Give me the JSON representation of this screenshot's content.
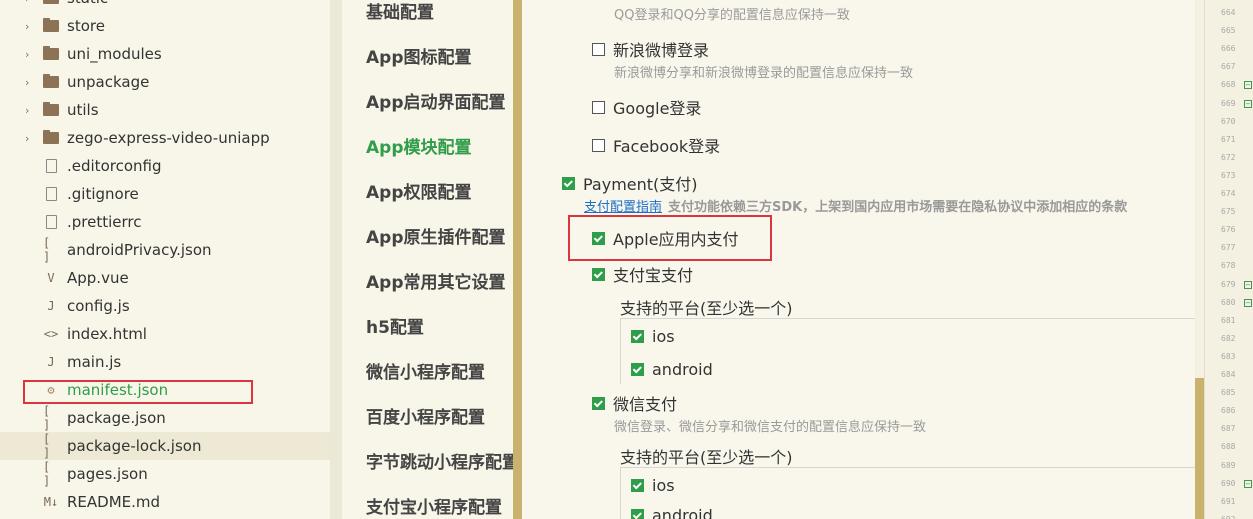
{
  "file_tree": {
    "items": [
      {
        "label": "static",
        "type": "folder"
      },
      {
        "label": "store",
        "type": "folder"
      },
      {
        "label": "uni_modules",
        "type": "folder"
      },
      {
        "label": "unpackage",
        "type": "folder"
      },
      {
        "label": "utils",
        "type": "folder"
      },
      {
        "label": "zego-express-video-uniapp",
        "type": "folder"
      },
      {
        "label": ".editorconfig",
        "type": "file",
        "icon": "file-icon"
      },
      {
        "label": ".gitignore",
        "type": "file",
        "icon": "file-icon"
      },
      {
        "label": ".prettierrc",
        "type": "file",
        "icon": "file-icon"
      },
      {
        "label": "androidPrivacy.json",
        "type": "file",
        "icon": "json-icon",
        "glyph": "[ ]"
      },
      {
        "label": "App.vue",
        "type": "file",
        "icon": "vue-icon",
        "glyph": "V"
      },
      {
        "label": "config.js",
        "type": "file",
        "icon": "js-icon",
        "glyph": "J"
      },
      {
        "label": "index.html",
        "type": "file",
        "icon": "html-icon",
        "glyph": "<>"
      },
      {
        "label": "main.js",
        "type": "file",
        "icon": "js-icon",
        "glyph": "J"
      },
      {
        "label": "manifest.json",
        "type": "file",
        "icon": "manifest-gear-icon",
        "glyph": "⚙",
        "active": true
      },
      {
        "label": "package.json",
        "type": "file",
        "icon": "json-icon",
        "glyph": "[ ]"
      },
      {
        "label": "package-lock.json",
        "type": "file",
        "icon": "json-icon",
        "glyph": "[ ]",
        "hover": true
      },
      {
        "label": "pages.json",
        "type": "file",
        "icon": "json-icon",
        "glyph": "[ ]"
      },
      {
        "label": "README.md",
        "type": "file",
        "icon": "markdown-icon",
        "glyph": "M↓"
      }
    ]
  },
  "settings_nav": {
    "items": [
      {
        "label": "基础配置"
      },
      {
        "label": "App图标配置"
      },
      {
        "label": "App启动界面配置"
      },
      {
        "label": "App模块配置",
        "active": true
      },
      {
        "label": "App权限配置"
      },
      {
        "label": "App原生插件配置"
      },
      {
        "label": "App常用其它设置"
      },
      {
        "label": "h5配置"
      },
      {
        "label": "微信小程序配置"
      },
      {
        "label": "百度小程序配置"
      },
      {
        "label": "字节跳动小程序配置"
      },
      {
        "label": "支付宝小程序配置"
      }
    ]
  },
  "content": {
    "qq_note": "QQ登录和QQ分享的配置信息应保持一致",
    "weibo_login": {
      "label": "新浪微博登录",
      "checked": false,
      "note": "新浪微博分享和新浪微博登录的配置信息应保持一致"
    },
    "google_login": {
      "label": "Google登录",
      "checked": false
    },
    "facebook_login": {
      "label": "Facebook登录",
      "checked": false
    },
    "payment": {
      "label": "Payment(支付)",
      "checked": true,
      "guide_link": "支付配置指南",
      "warning": "支付功能依赖三方SDK，上架到国内应用市场需要在隐私协议中添加相应的条款"
    },
    "apple_pay": {
      "label": "Apple应用内支付",
      "checked": true
    },
    "alipay": {
      "label": "支付宝支付",
      "checked": true,
      "platform_title": "支持的平台(至少选一个)",
      "platforms": [
        {
          "label": "ios",
          "checked": true
        },
        {
          "label": "android",
          "checked": true
        }
      ]
    },
    "wechat_pay": {
      "label": "微信支付",
      "checked": true,
      "note": "微信登录、微信分享和微信支付的配置信息应保持一致",
      "platform_title": "支持的平台(至少选一个)",
      "platforms": [
        {
          "label": "ios",
          "checked": true
        },
        {
          "label": "android",
          "checked": true
        }
      ]
    }
  },
  "gutter": {
    "line_numbers": [
      "664",
      "665",
      "666",
      "667",
      "668",
      "669",
      "670",
      "671",
      "672",
      "673",
      "674",
      "675",
      "676",
      "677",
      "678",
      "679",
      "680",
      "681",
      "682",
      "683",
      "684",
      "685",
      "686",
      "687",
      "688",
      "689",
      "690",
      "691",
      "692"
    ],
    "fold_markers": [
      "668",
      "669",
      "679",
      "680",
      "690"
    ]
  },
  "colors": {
    "active_green": "#2f9d4a",
    "highlight_red": "#d9363e",
    "accent_gold": "#c9b16e",
    "link_blue": "#1a6fc9"
  }
}
